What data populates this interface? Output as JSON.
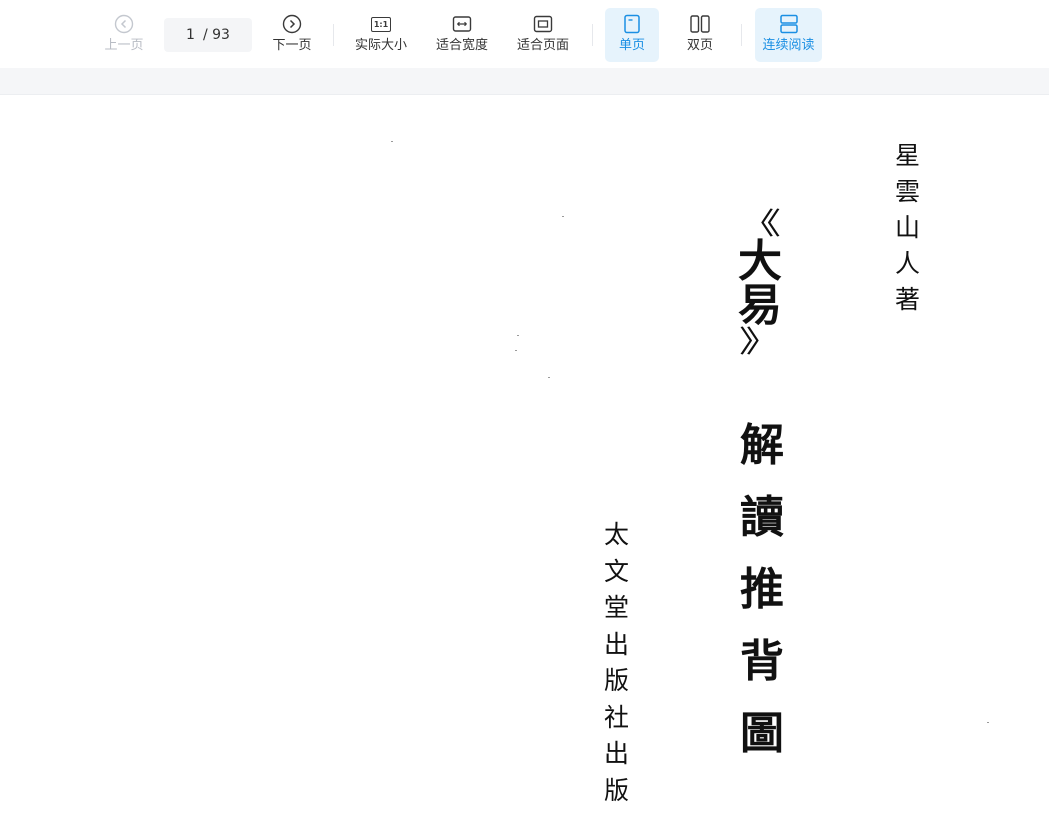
{
  "toolbar": {
    "prev_label": "上一页",
    "next_label": "下一页",
    "page_current": "1",
    "page_total": "/ 93",
    "actual_size_label": "实际大小",
    "actual_size_icon_text": "1:1",
    "fit_width_label": "适合宽度",
    "fit_page_label": "适合页面",
    "single_page_label": "单页",
    "double_page_label": "双页",
    "continuous_label": "连续阅读",
    "active_view_modes": [
      "单页",
      "连续阅读"
    ],
    "accent_color": "#1a8fe3",
    "icons": [
      "chevron-left-circle-icon",
      "chevron-right-circle-icon",
      "actual-size-icon",
      "fit-width-icon",
      "fit-page-icon",
      "single-page-icon",
      "double-page-icon",
      "continuous-read-icon"
    ]
  },
  "document": {
    "author": [
      "星",
      "雲",
      "山",
      "人",
      "著"
    ],
    "title_open": "《",
    "title_book": [
      "大",
      "易"
    ],
    "title_close": "》",
    "title_rest": [
      "解",
      "讀",
      "推",
      "背",
      "圖"
    ],
    "publisher": [
      "太",
      "文",
      "堂",
      "出",
      "版",
      "社",
      "出",
      "版"
    ]
  }
}
